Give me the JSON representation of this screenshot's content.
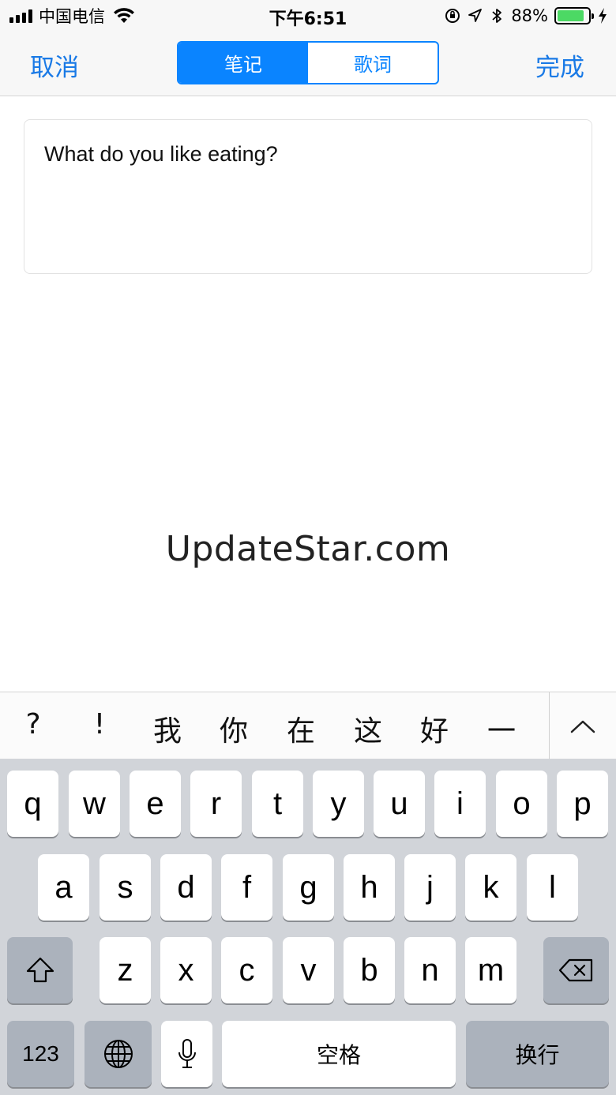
{
  "status_bar": {
    "carrier": "中国电信",
    "time": "下午6:51",
    "battery_percent": "88%",
    "battery_level": 0.88,
    "battery_color": "#4cd964",
    "icons": [
      "signal-icon",
      "wifi-icon",
      "orientation-lock-icon",
      "location-arrow-icon",
      "bluetooth-icon",
      "battery-icon",
      "charging-bolt-icon"
    ]
  },
  "nav": {
    "cancel_label": "取消",
    "done_label": "完成",
    "segments": [
      {
        "label": "笔记",
        "selected": true
      },
      {
        "label": "歌词",
        "selected": false
      }
    ],
    "accent_color": "#0a84ff"
  },
  "note": {
    "text": "What do you like eating?"
  },
  "watermark": {
    "text": "UpdateStar.com"
  },
  "candidates": {
    "items": [
      "?",
      "!",
      "我",
      "你",
      "在",
      "这",
      "好",
      "一"
    ],
    "expand_icon": "chevron-up-icon"
  },
  "keyboard": {
    "row1": [
      "q",
      "w",
      "e",
      "r",
      "t",
      "y",
      "u",
      "i",
      "o",
      "p"
    ],
    "row2": [
      "a",
      "s",
      "d",
      "f",
      "g",
      "h",
      "j",
      "k",
      "l"
    ],
    "row3": [
      "z",
      "x",
      "c",
      "v",
      "b",
      "n",
      "m"
    ],
    "shift_icon": "shift-icon",
    "delete_icon": "backspace-icon",
    "numbers_label": "123",
    "globe_icon": "globe-icon",
    "mic_icon": "microphone-icon",
    "space_label": "空格",
    "return_label": "换行"
  }
}
